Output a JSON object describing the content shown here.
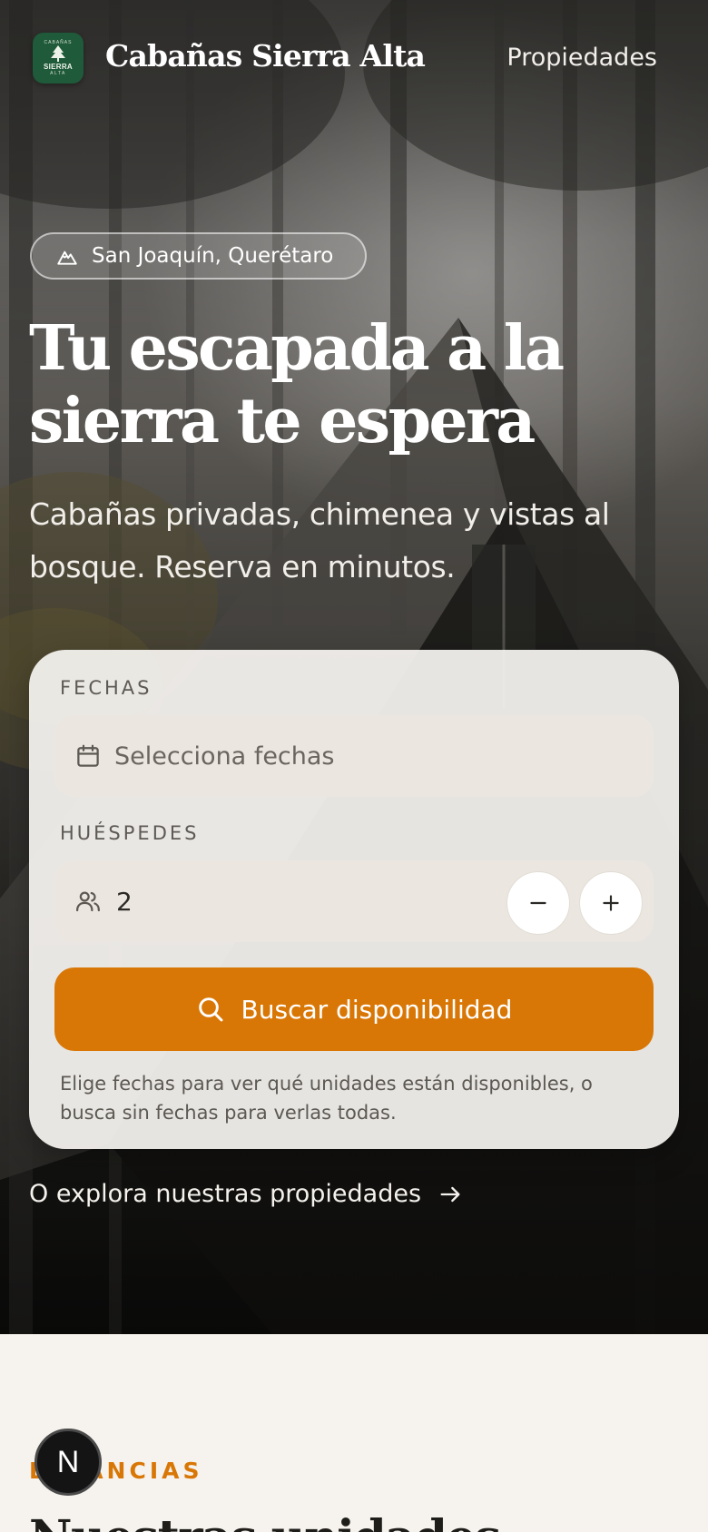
{
  "header": {
    "logo": {
      "top": "CABAÑAS",
      "main": "SIERRA",
      "bottom": "ALTA"
    },
    "brand": "Cabañas Sierra Alta",
    "nav_link": "Propiedades"
  },
  "hero": {
    "location_chip": {
      "icon": "mountain-icon",
      "label": "San Joaquín, Querétaro"
    },
    "headline_line1": "Tu escapada a la",
    "headline_line2": "sierra te espera",
    "subheadline": "Cabañas privadas, chimenea y vistas al bosque. Reserva en minutos."
  },
  "search_card": {
    "dates_label": "FECHAS",
    "dates_placeholder": "Selecciona fechas",
    "dates_icon": "calendar-icon",
    "guests_label": "HUÉSPEDES",
    "guests_icon": "users-icon",
    "guests_value": "2",
    "decrement_icon": "minus-icon",
    "increment_icon": "plus-icon",
    "search_button": "Buscar disponibilidad",
    "search_icon": "search-icon",
    "hint": "Elige fechas para ver qué unidades están disponibles, o busca sin fechas para verlas todas."
  },
  "explore_link": {
    "label": "O explora nuestras propiedades",
    "icon": "arrow-right-icon"
  },
  "section": {
    "eyebrow": "ESTANCIAS",
    "title": "Nuestras unidades"
  },
  "dev_badge": {
    "label": "N"
  },
  "colors": {
    "accent": "#d97706",
    "logo_bg": "#1f5a3a",
    "page_bg": "#f6f3ee"
  }
}
